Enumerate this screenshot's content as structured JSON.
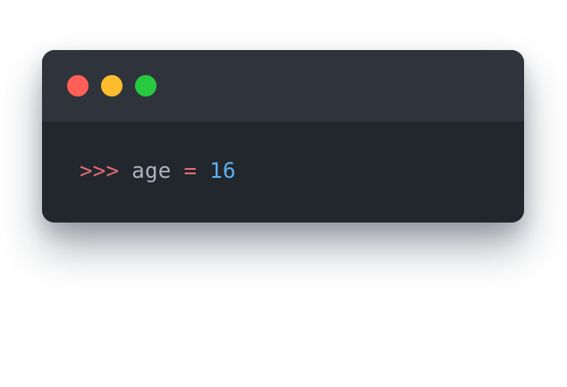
{
  "window": {
    "controls": {
      "close_color": "#ff5f56",
      "minimize_color": "#ffbd2e",
      "maximize_color": "#27c93f"
    }
  },
  "code": {
    "prompt": ">>>",
    "variable": "age",
    "operator": "=",
    "value": "16"
  },
  "colors": {
    "prompt": "#e06c75",
    "variable": "#abb2bf",
    "operator": "#e06c75",
    "value": "#61afef"
  }
}
